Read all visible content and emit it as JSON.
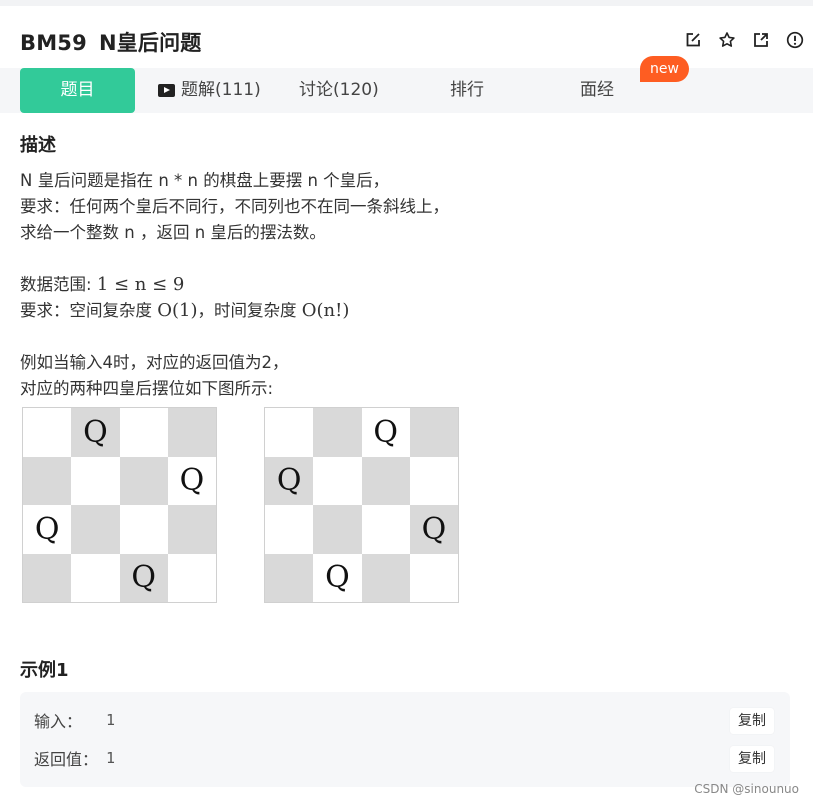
{
  "problem": {
    "id": "BM59",
    "name": "N皇后问题"
  },
  "header_icons": [
    "edit-icon",
    "star-icon",
    "external-link-icon",
    "info-icon"
  ],
  "tabs": {
    "question": "题目",
    "solution": "题解(111)",
    "discuss": "讨论(120)",
    "rank": "排行",
    "interview": "面经",
    "new_badge": "new"
  },
  "colors": {
    "accent": "#32ca99",
    "badge": "#fe5d22",
    "board_dark": "#d9d9d9"
  },
  "description": {
    "heading": "描述",
    "line1": "N 皇后问题是指在 n * n 的棋盘上要摆 n 个皇后，",
    "line2": "要求：任何两个皇后不同行，不同列也不在同一条斜线上，",
    "line3": "求给一个整数 n ，返回 n 皇后的摆法数。",
    "range_label": "数据范围: ",
    "range_math": "1 ≤ n ≤ 9",
    "req_label": "要求：空间复杂度 ",
    "space_math": "O(1)",
    "req_mid": "，时间复杂度 ",
    "time_math": "O(n!)",
    "example_line1": "例如当输入4时，对应的返回值为2，",
    "example_line2": "对应的两种四皇后摆位如下图所示:"
  },
  "boards": [
    {
      "queen_symbol": "Q",
      "rows": [
        [
          "",
          "Q",
          "",
          ""
        ],
        [
          "",
          "",
          "",
          "Q"
        ],
        [
          "Q",
          "",
          "",
          ""
        ],
        [
          "",
          "",
          "Q",
          ""
        ]
      ]
    },
    {
      "queen_symbol": "Q",
      "rows": [
        [
          "",
          "",
          "Q",
          ""
        ],
        [
          "Q",
          "",
          "",
          ""
        ],
        [
          "",
          "",
          "",
          "Q"
        ],
        [
          "",
          "Q",
          "",
          ""
        ]
      ]
    }
  ],
  "example": {
    "heading": "示例1",
    "input_label": "输入：",
    "input_value": "1",
    "output_label": "返回值：",
    "output_value": "1",
    "copy_label": "复制"
  },
  "watermark": "CSDN @sinounuo"
}
